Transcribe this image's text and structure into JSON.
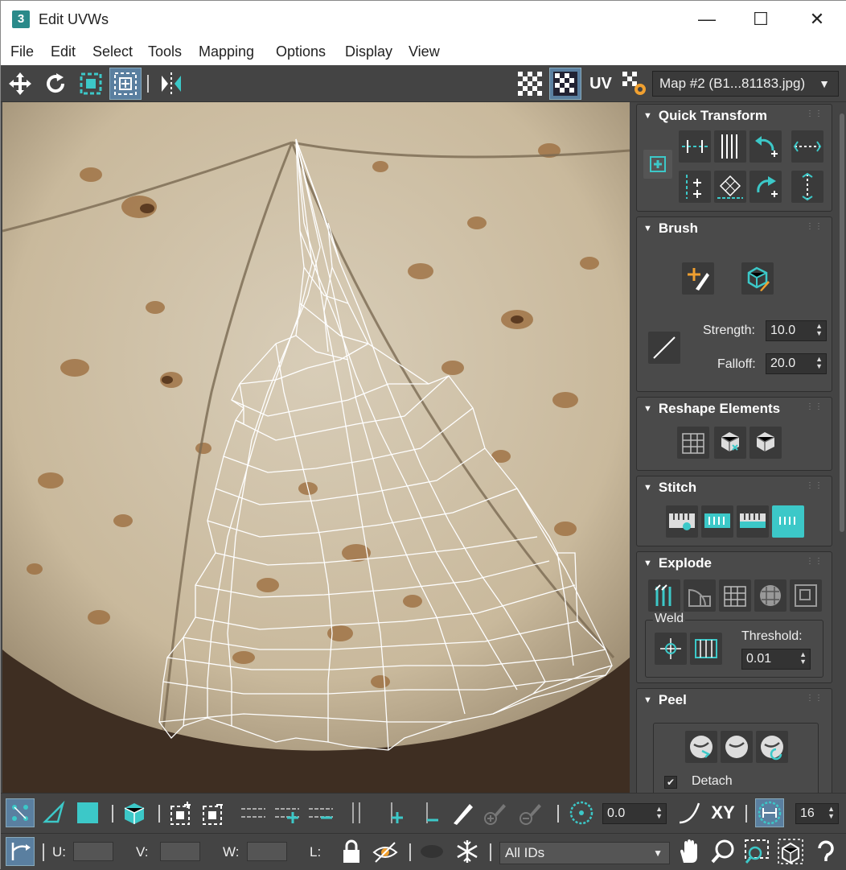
{
  "window": {
    "app_icon": "3",
    "title": "Edit UVWs",
    "controls": [
      "—",
      "☐",
      "✕"
    ]
  },
  "menu": [
    "File",
    "Edit",
    "Select",
    "Tools",
    "Mapping",
    "Options",
    "Display",
    "View"
  ],
  "toolbar": {
    "uv_label": "UV",
    "map_select": "Map #2 (B1...81183.jpg)"
  },
  "panel": {
    "quick_transform": "Quick Transform",
    "brush": "Brush",
    "strength_label": "Strength:",
    "strength_value": "10.0",
    "falloff_label": "Falloff:",
    "falloff_value": "20.0",
    "reshape": "Reshape Elements",
    "stitch": "Stitch",
    "explode": "Explode",
    "weld_label": "Weld",
    "threshold_label": "Threshold:",
    "threshold_value": "0.01",
    "peel": "Peel",
    "detach_label": "Detach",
    "detach_checked": "✔"
  },
  "bottom": {
    "rotate_value": "0.0",
    "xy_label": "XY",
    "grid_value": "16",
    "u_label": "U:",
    "v_label": "V:",
    "w_label": "W:",
    "l_label": "L:",
    "ids_select": "All IDs"
  },
  "colors": {
    "accent": "#3cc8c8",
    "highlight": "#5a7fa0",
    "wire": "#ffffff"
  }
}
